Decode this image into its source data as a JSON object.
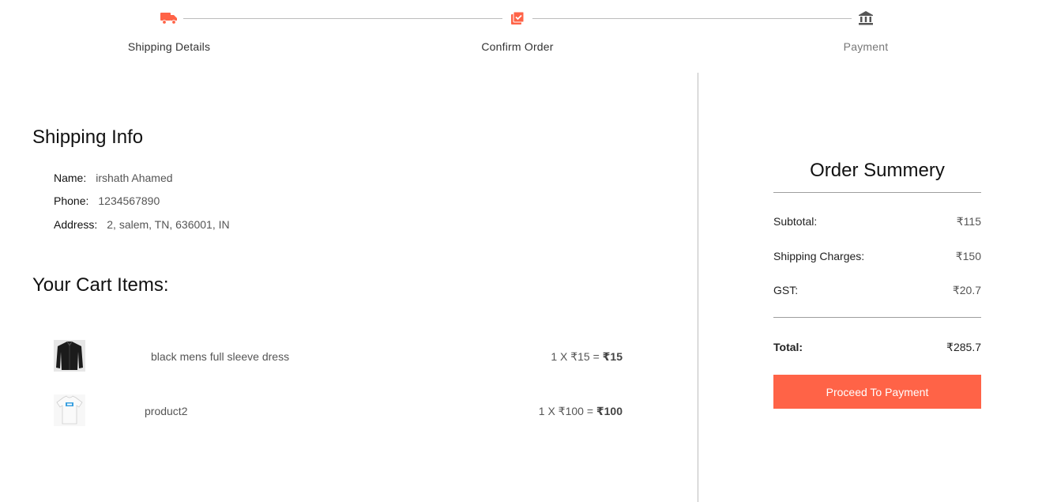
{
  "stepper": {
    "steps": [
      {
        "label": "Shipping Details",
        "state": "active",
        "icon": "truck-icon"
      },
      {
        "label": "Confirm Order",
        "state": "active",
        "icon": "library-add-check-icon"
      },
      {
        "label": "Payment",
        "state": "inactive",
        "icon": "bank-icon"
      }
    ]
  },
  "colors": {
    "accent": "#ff6347",
    "inactive_icon": "#555555",
    "divider": "#bdbdbd"
  },
  "shipping": {
    "title": "Shipping Info",
    "name_label": "Name:",
    "name_value": "irshath Ahamed",
    "phone_label": "Phone:",
    "phone_value": "1234567890",
    "address_label": "Address:",
    "address_value": "2, salem, TN, 636001, IN"
  },
  "cart": {
    "title": "Your Cart Items:",
    "items": [
      {
        "name": "black mens full sleeve dress",
        "qty_price": "1 X ₹15 = ",
        "total": "₹15",
        "thumb": "black-jacket-image"
      },
      {
        "name": "product2",
        "qty_price": "1 X ₹100 = ",
        "total": "₹100",
        "thumb": "white-tshirt-image"
      }
    ]
  },
  "summary": {
    "title": "Order Summery",
    "subtotal_label": "Subtotal:",
    "subtotal_value": "₹115",
    "shipping_label": "Shipping Charges:",
    "shipping_value": "₹150",
    "gst_label": "GST:",
    "gst_value": "₹20.7",
    "total_label": "Total:",
    "total_value": "₹285.7",
    "button_label": "Proceed To Payment"
  }
}
